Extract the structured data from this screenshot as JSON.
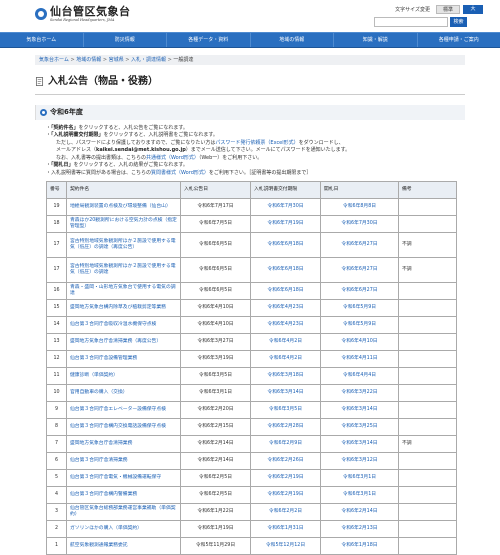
{
  "header": {
    "title_jp": "仙台管区気象台",
    "title_en": "Sendai Regional Headquarters, JMA",
    "fontsize_label": "文字サイズ変更",
    "btn_standard": "標準",
    "btn_large": "大",
    "search_button": "検索",
    "search_value": ""
  },
  "nav": [
    "気象台ホーム",
    "防災情報",
    "各種データ・資料",
    "地域の情報",
    "知識・解説",
    "各種申請・ご案内"
  ],
  "breadcrumb": [
    "気象台ホーム",
    "地域の情報",
    "宮城県",
    "入札・調達情報",
    "一般調達"
  ],
  "page_title": "入札公告（物品・役務）",
  "section_title": "令和6年度",
  "notes": {
    "l1a": "「契約件名」",
    "l1b": "をクリックすると、入札公告をご覧になれます。",
    "l2a": "「入札説明書交付期限」",
    "l2b": "をクリックすると、入札説明書をご覧になれます。",
    "l3a": "ただし、パスワードにより保護しておりますので、ご覧になりたい方は",
    "l3link": "パスワード発行依頼票（Excel形式）",
    "l3b": "をダウンロードし、",
    "l4a": "メールアドレス（",
    "l4email": "kaikei.sendai@met.kishou.go.jp",
    "l4b": "）までメール送信して下さい。メールにてパスワードを通知いたします。",
    "l5a": "なお、入札書等の提出書類は、こちらの",
    "l5link": "共通様式（Word形式）",
    "l5b": "（Web一）をご利用下さい。",
    "l6a": "「開札日」",
    "l6b": "をクリックすると、入札の結果がご覧になれます。",
    "l7a": "入札説明書等に質問がある場合は、こちらの",
    "l7link": "質問書様式（Word形式）",
    "l7b": "をご利用下さい。［証明書等の提出期限まで］"
  },
  "table": {
    "headers": [
      "番号",
      "契約件名",
      "入札公告日",
      "入札説明書交付期限",
      "開札日",
      "備考"
    ],
    "rows": [
      {
        "no": "19",
        "name": "地絵局観測装置の点検及び環境整備（仙台山）",
        "date": "令和6年7月17日",
        "deadline": "令和6年7月30日",
        "open": "令和6年8月8日",
        "note": "",
        "tall": false
      },
      {
        "no": "18",
        "name": "青森ほか20観測所における空気力計の点検（指定管理型）",
        "date": "令和6年7月5日",
        "deadline": "令和6年7月19日",
        "open": "令和6年7月30日",
        "note": "",
        "tall": false
      },
      {
        "no": "17",
        "name": "宮古特別地域気象観測所ほか２施設で使用する電気（低圧）の調達（再度公告）",
        "date": "令和6年6月5日",
        "deadline": "令和6年6月18日",
        "open": "令和6年6月27日",
        "note": "不調",
        "tall": true
      },
      {
        "no": "17",
        "name": "宮古特別地域気象観測所ほか２施設で使用する電気（低圧）の調達",
        "date": "令和6年6月5日",
        "deadline": "令和6年6月18日",
        "open": "令和6年6月27日",
        "note": "不調",
        "tall": true
      },
      {
        "no": "16",
        "name": "青森・盛岡・山形地方気象台で使用する電気の調達",
        "date": "令和6年6月5日",
        "deadline": "令和6年6月18日",
        "open": "令和6年6月27日",
        "note": "",
        "tall": false
      },
      {
        "no": "15",
        "name": "盛岡地方気象台構内除草及び植栽剪定等業務",
        "date": "令和6年4月10日",
        "deadline": "令和6年4月23日",
        "open": "令和6年5月9日",
        "note": "",
        "tall": false
      },
      {
        "no": "14",
        "name": "仙台第３合同庁舎吸収冷温水機保守点検",
        "date": "令和6年4月10日",
        "deadline": "令和6年4月23日",
        "open": "令和6年5月9日",
        "note": "",
        "tall": false
      },
      {
        "no": "13",
        "name": "盛岡地方気象台庁舎清掃業務（再度公告）",
        "date": "令和6年3月27日",
        "deadline": "令和6年4月2日",
        "open": "令和6年4月10日",
        "note": "",
        "tall": false
      },
      {
        "no": "12",
        "name": "仙台第３合同庁舎設備管理業務",
        "date": "令和6年3月19日",
        "deadline": "令和6年4月2日",
        "open": "令和6年4月11日",
        "note": "",
        "tall": false
      },
      {
        "no": "11",
        "name": "健康診断（単価契約）",
        "date": "令和6年3月5日",
        "deadline": "令和6年3月18日",
        "open": "令和6年4月4日",
        "note": "",
        "tall": false
      },
      {
        "no": "10",
        "name": "官用自動車の購入（交換）",
        "date": "令和6年3月1日",
        "deadline": "令和6年3月14日",
        "open": "令和6年3月22日",
        "note": "",
        "tall": false
      },
      {
        "no": "9",
        "name": "仙台第３合同庁舎エレベーター設備保守点検",
        "date": "令和6年2月20日",
        "deadline": "令和6年3月5日",
        "open": "令和6年3月14日",
        "note": "",
        "tall": false
      },
      {
        "no": "8",
        "name": "仙台第３合同庁舎構内交換電話設備保守点検",
        "date": "令和6年2月15日",
        "deadline": "令和6年2月28日",
        "open": "令和6年3月25日",
        "note": "",
        "tall": false
      },
      {
        "no": "7",
        "name": "盛岡地方気象台庁舎清掃業務",
        "date": "令和6年2月14日",
        "deadline": "令和6年2月9日",
        "open": "令和6年3月14日",
        "note": "不調",
        "tall": false
      },
      {
        "no": "6",
        "name": "仙台第３合同庁舎清掃業務",
        "date": "令和6年2月14日",
        "deadline": "令和6年2月26日",
        "open": "令和6年3月12日",
        "note": "",
        "tall": false
      },
      {
        "no": "5",
        "name": "仙台第３合同庁舎電気・機械設備運転保守",
        "date": "令和6年2月5日",
        "deadline": "令和6年2月19日",
        "open": "令和6年3月1日",
        "note": "",
        "tall": false
      },
      {
        "no": "4",
        "name": "仙台第３合同庁舎構内警備業務",
        "date": "令和6年2月5日",
        "deadline": "令和6年2月19日",
        "open": "令和6年3月1日",
        "note": "",
        "tall": false
      },
      {
        "no": "3",
        "name": "仙台管区気象台総務部業務運営事業補助（単価契約）",
        "date": "令和6年1月22日",
        "deadline": "令和6年2月2日",
        "open": "令和6年2月14日",
        "note": "",
        "tall": false
      },
      {
        "no": "2",
        "name": "ガソリンほかの購入（単価契約）",
        "date": "令和6年1月19日",
        "deadline": "令和6年1月31日",
        "open": "令和6年2月13日",
        "note": "",
        "tall": false
      },
      {
        "no": "1",
        "name": "航空気象観測通報業務委託",
        "date": "令和5年11月29日",
        "deadline": "令和5年12月12日",
        "open": "令和6年1月18日",
        "note": "",
        "tall": false
      }
    ]
  }
}
